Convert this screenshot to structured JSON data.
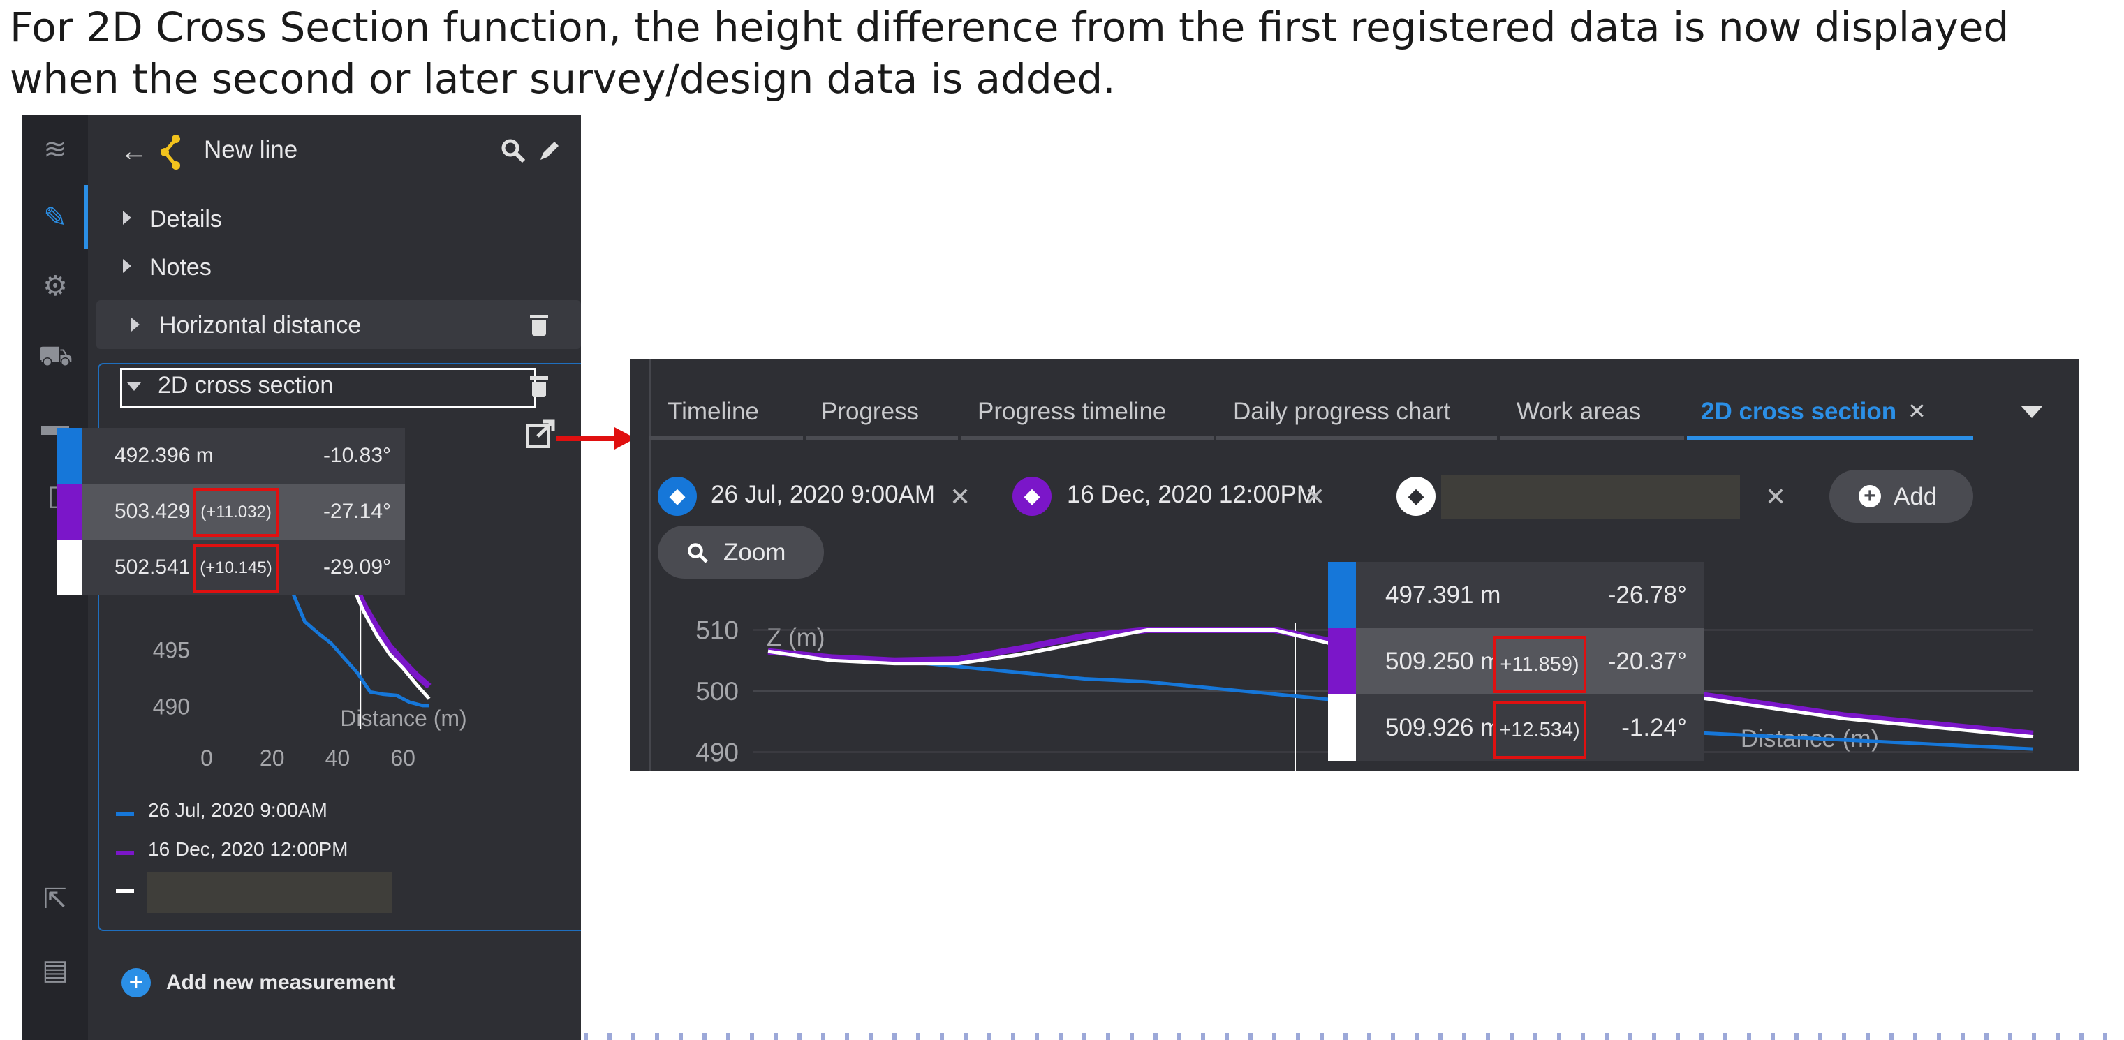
{
  "caption": "For 2D Cross Section function, the height difference from the first registered data is now displayed when the second or later survey/design data is added.",
  "colors": {
    "blue": "#1677d9",
    "purple": "#7b16c9",
    "white": "#ffffff",
    "red_highlight": "#e01010"
  },
  "left_panel": {
    "header_title": "New line",
    "items": {
      "details": "Details",
      "notes": "Notes",
      "horizontal_distance": "Horizontal distance",
      "cross_section": "2D cross section"
    },
    "tooltip_rows": [
      {
        "value": "492.396 m",
        "diff": "",
        "angle": "-10.83°"
      },
      {
        "value": "503.429 m",
        "diff": "(+11.032)",
        "angle": "-27.14°"
      },
      {
        "value": "502.541 m",
        "diff": "(+10.145)",
        "angle": "-29.09°"
      }
    ],
    "legend": [
      "26 Jul, 2020 9:00AM",
      "16 Dec, 2020 12:00PM"
    ],
    "add_measurement": "Add new measurement",
    "icons": [
      "layers-icon",
      "ruler-pencil-icon",
      "gear-icon",
      "truck-icon",
      "folder-icon",
      "tablet-icon",
      "export-icon",
      "pdf-icon"
    ]
  },
  "right_panel": {
    "tabs": [
      "Timeline",
      "Progress",
      "Progress timeline",
      "Daily progress chart",
      "Work areas",
      "2D cross section"
    ],
    "active_tab": "2D cross section",
    "chips": [
      "26 Jul, 2020 9:00AM",
      "16 Dec, 2020 12:00PM"
    ],
    "add_label": "Add",
    "zoom_label": "Zoom",
    "tooltip_rows": [
      {
        "value": "497.391 m",
        "diff": "",
        "angle": "-26.78°"
      },
      {
        "value": "509.250 m",
        "diff": "+11.859)",
        "angle": "-20.37°"
      },
      {
        "value": "509.926 m",
        "diff": "+12.534)",
        "angle": "-1.24°"
      }
    ]
  },
  "chart_data": [
    {
      "type": "line",
      "xlabel": "Distance (m)",
      "ylabel": "",
      "x_ticks": [
        "0",
        "20",
        "40",
        "60"
      ],
      "y_ticks": [
        "495",
        "490"
      ],
      "xlim": [
        0,
        70
      ],
      "ylim": [
        488,
        512
      ],
      "series": [
        {
          "name": "26 Jul, 2020 9:00AM",
          "x": [
            22,
            30,
            34,
            38,
            42,
            46,
            50,
            54,
            58,
            62,
            66,
            68
          ],
          "y": [
            503.0,
            497.5,
            496.5,
            495.6,
            494.3,
            493.0,
            491.3,
            491.1,
            491.0,
            490.4,
            490.1,
            490.1
          ]
        },
        {
          "name": "16 Dec, 2020 12:00PM",
          "x": [
            40,
            44,
            48,
            52,
            56,
            60,
            64,
            68
          ],
          "y": [
            504.0,
            501.5,
            499.0,
            497.0,
            495.3,
            494.0,
            492.8,
            491.8
          ]
        },
        {
          "name": "",
          "x": [
            40,
            44,
            48,
            52,
            56,
            60,
            64,
            68
          ],
          "y": [
            503.5,
            501.0,
            498.4,
            496.3,
            494.6,
            493.4,
            492.0,
            490.7
          ]
        }
      ]
    },
    {
      "type": "line",
      "xlabel": "Distance (m)",
      "ylabel": "Z (m)",
      "y_ticks": [
        "510",
        "500",
        "490"
      ],
      "xlim": [
        0,
        100
      ],
      "ylim": [
        488,
        512
      ],
      "series": [
        {
          "name": "26 Jul, 2020 9:00AM",
          "x": [
            0,
            5,
            10,
            15,
            20,
            25,
            30,
            35,
            40,
            45,
            50,
            55,
            60,
            65,
            70,
            75,
            80,
            85,
            90,
            95,
            100
          ],
          "y": [
            506.5,
            505.5,
            505.0,
            504.0,
            503.0,
            502.0,
            501.5,
            500.5,
            499.5,
            498.5,
            497.5,
            496.5,
            495.5,
            494.5,
            493.5,
            493.0,
            492.5,
            492.0,
            491.5,
            491.0,
            490.5
          ]
        },
        {
          "name": "16 Dec, 2020 12:00PM",
          "x": [
            0,
            5,
            10,
            15,
            20,
            25,
            30,
            35,
            40,
            45,
            50,
            55,
            60,
            65,
            70,
            75,
            80,
            85,
            90,
            95,
            100
          ],
          "y": [
            506.5,
            505.5,
            505.0,
            505.2,
            507.0,
            509.0,
            510.0,
            510.0,
            510.0,
            508.0,
            506.5,
            505.0,
            503.5,
            502.0,
            500.5,
            499.0,
            497.5,
            496.0,
            495.0,
            494.0,
            493.0
          ]
        },
        {
          "name": "",
          "x": [
            0,
            5,
            10,
            15,
            20,
            25,
            30,
            35,
            40,
            45,
            50,
            55,
            60,
            65,
            70,
            75,
            80,
            85,
            90,
            95,
            100
          ],
          "y": [
            506.5,
            505.0,
            504.5,
            504.5,
            506.0,
            508.0,
            510.0,
            510.0,
            510.0,
            507.5,
            506.0,
            504.5,
            503.0,
            501.5,
            500.0,
            498.5,
            497.0,
            495.5,
            494.5,
            493.5,
            492.5
          ]
        }
      ]
    }
  ]
}
